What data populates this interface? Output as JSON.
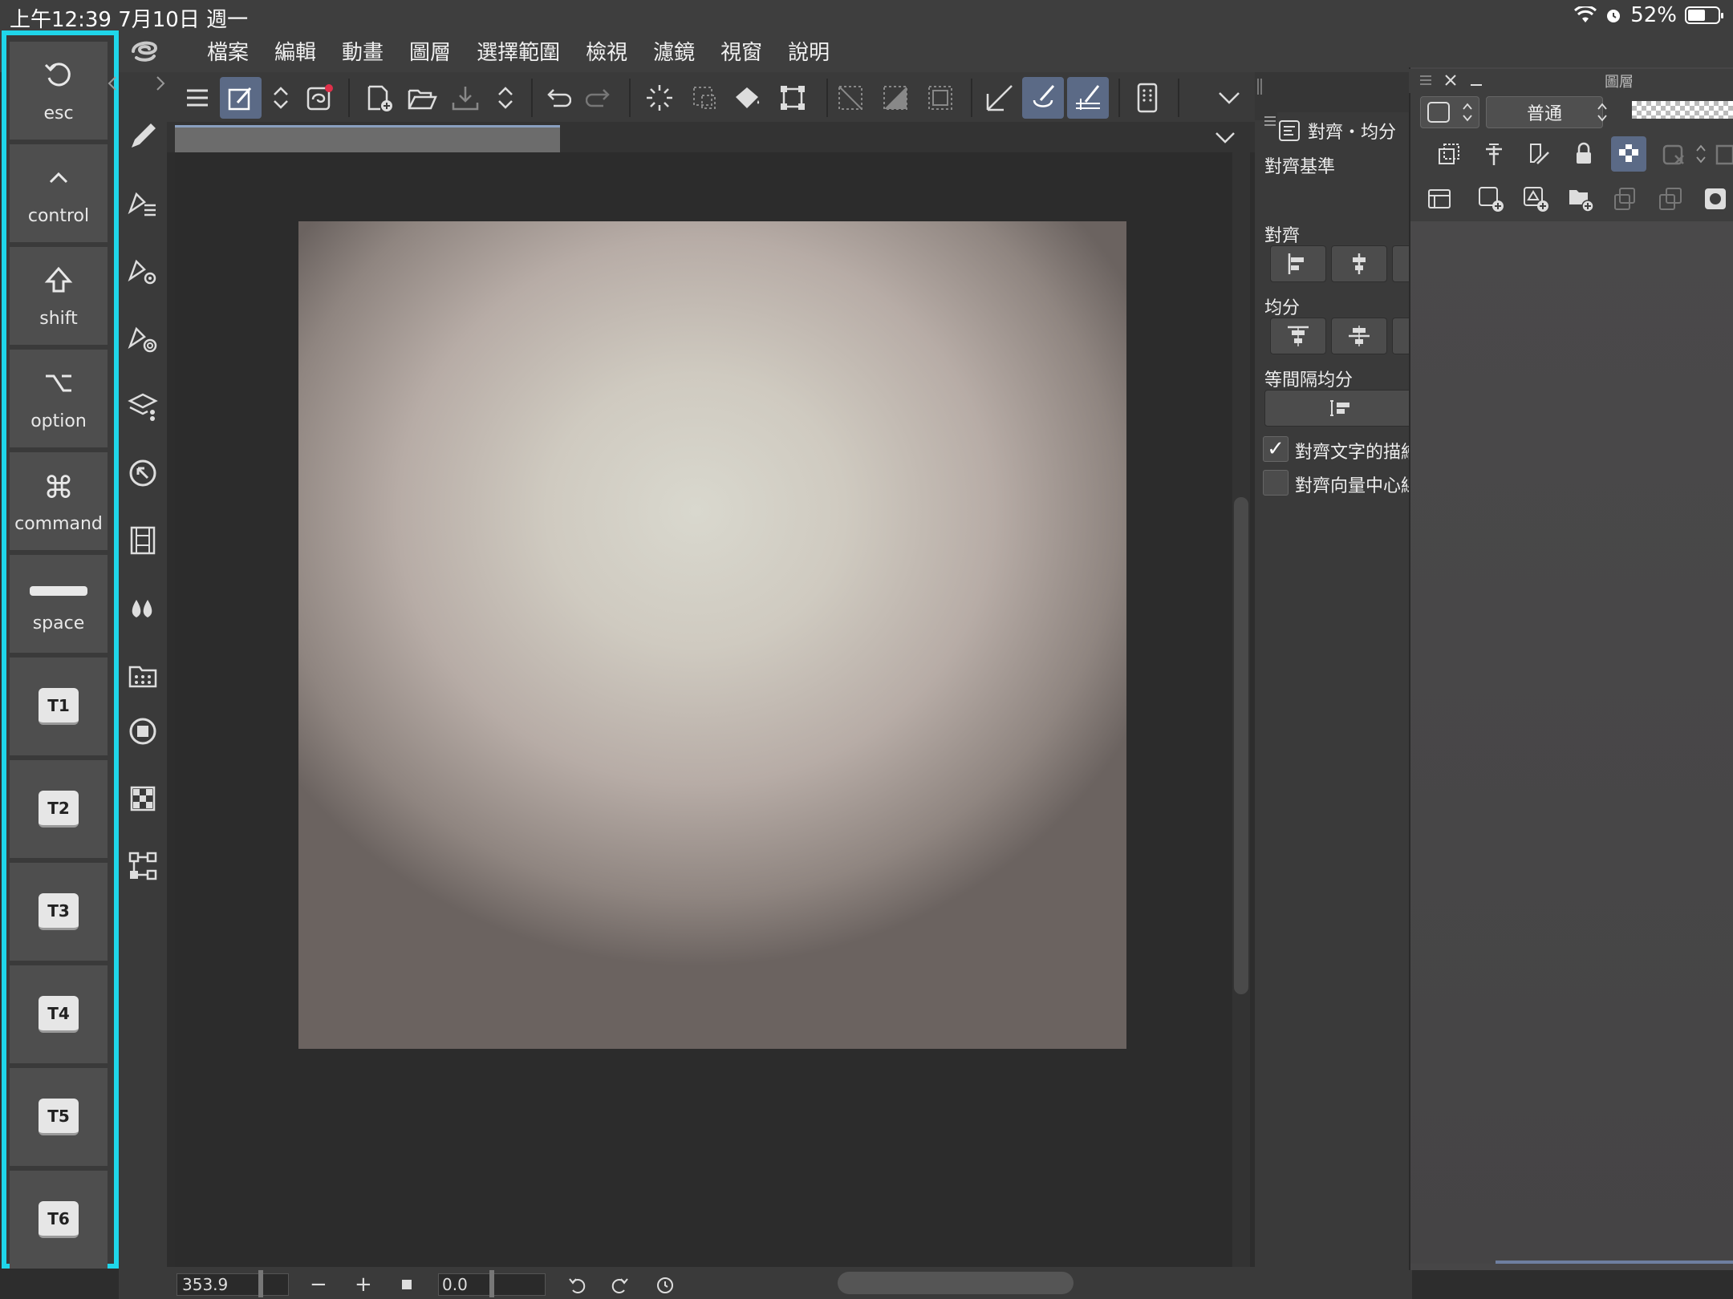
{
  "status_bar": {
    "time_date": "上午12:39   7月10日 週一",
    "battery": "52%",
    "battery_level": 0.52
  },
  "menu": {
    "items": [
      "檔案",
      "編輯",
      "動畫",
      "圖層",
      "選擇範圍",
      "檢視",
      "濾鏡",
      "視窗",
      "說明"
    ]
  },
  "keys": {
    "esc": "esc",
    "control": "control",
    "shift": "shift",
    "option": "option",
    "command": "command",
    "space": "space",
    "t1": "T1",
    "t2": "T2",
    "t3": "T3",
    "t4": "T4",
    "t5": "T5",
    "t6": "T6"
  },
  "bottom": {
    "zoom": "353.9",
    "rotation": "0.0"
  },
  "property_panel": {
    "tab_label": "對齊・均分",
    "align_base_label": "對齊基準",
    "align_label": "對齊",
    "distribute_label": "均分",
    "equal_spacing_label": "等間隔均分",
    "check1_label": "對齊文字的描繪",
    "check2_label": "對齊向量中心線",
    "check1_checked": true,
    "check2_checked": false
  },
  "layer_panel": {
    "title": "圖層",
    "blend_mode": "普通"
  },
  "colors": {
    "highlight": "#1fd6ea",
    "active_tool": "#5b6a86"
  }
}
